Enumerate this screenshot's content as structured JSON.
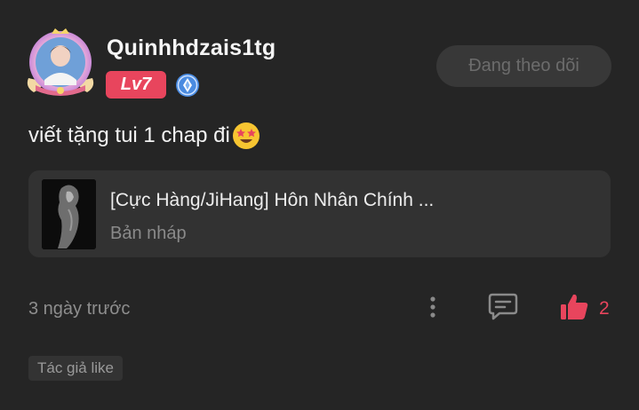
{
  "comment": {
    "user": {
      "username": "Quinhhdzais1tg",
      "level": "Lv7",
      "avatar_icon": "avatar-frame-icon",
      "verify_icon": "diamond-badge-icon"
    },
    "follow_button_label": "Đang theo dõi",
    "text": "viết tặng tui 1 chap đi",
    "emoji_icon": "star-struck-emoji-icon",
    "story": {
      "title": "[Cực Hàng/JiHang] Hôn Nhân Chính ...",
      "status": "Bản nháp"
    },
    "timestamp": "3 ngày trước",
    "likes": "2",
    "author_like_label": "Tác giả like"
  },
  "colors": {
    "background": "#252525",
    "accent": "#e8455d",
    "card": "#323232",
    "muted_text": "#8e8e8e"
  }
}
